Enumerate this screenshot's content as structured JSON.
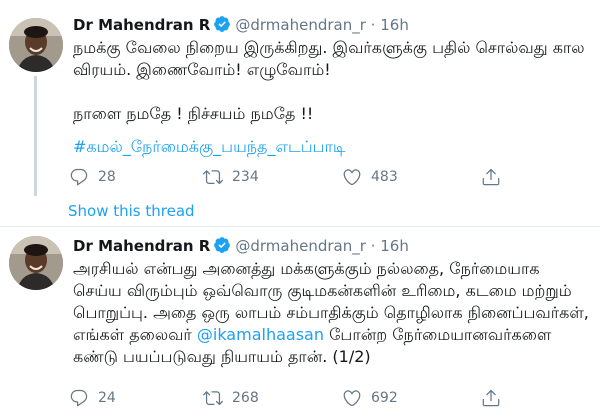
{
  "tweets": [
    {
      "name": "Dr Mahendran R",
      "handle": "@drmahendran_r",
      "separator": "·",
      "time": "16h",
      "text": "நமக்கு வேலை நிறைய இருக்கிறது. இவர்களுக்கு பதில் சொல்வது கால விரயம். இணைவோம்! எழுவோம்!\n\nநாளை நமதே ! நிச்சயம் நமதே !!",
      "hashtag": "#கமல்_நேர்மைக்கு_பயந்த_எடப்பாடி",
      "replies": "28",
      "retweets": "234",
      "likes": "483"
    },
    {
      "name": "Dr Mahendran R",
      "handle": "@drmahendran_r",
      "separator": "·",
      "time": "16h",
      "text_before_mention": "அரசியல் என்பது அனைத்து மக்களுக்கும் நல்லதை, நேர்மையாக செய்ய விரும்பும் ஒவ்வொரு குடிமகன்களின் உரிமை, கடமை மற்றும் பொறுப்பு. அதை ஒரு லாபம் சம்பாதிக்கும் தொழிலாக நினைப்பவர்கள், எங்கள் தலைவர்",
      "mention": "@ikamalhaasan",
      "text_after_mention": " போன்ற நேர்மையானவர்களை கண்டு பயப்படுவது நியாயம் தான். (1/2)",
      "replies": "24",
      "retweets": "268",
      "likes": "692"
    }
  ],
  "show_thread": "Show this thread",
  "icons": {
    "verified": "verified-badge-icon",
    "reply": "reply-icon",
    "retweet": "retweet-icon",
    "like": "heart-icon",
    "share": "share-icon"
  },
  "colors": {
    "link": "#1da1f2",
    "muted": "#657786",
    "text": "#14171a",
    "thread_line": "#ccd6dd"
  }
}
